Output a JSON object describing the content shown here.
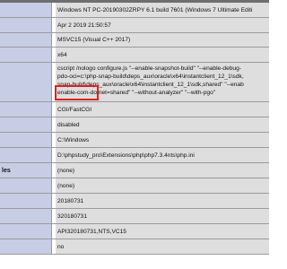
{
  "phpinfo": {
    "rows": [
      {
        "label": "",
        "value": "Windows NT PC-20190302ZRPY 6.1 build 7601 (Windows 7 Ultimate Editi"
      },
      {
        "label": "",
        "value": "Apr 2 2019 21:50:57"
      },
      {
        "label": "",
        "value": "MSVC15 (Visual C++ 2017)"
      },
      {
        "label": "",
        "value": "x64"
      },
      {
        "label": "",
        "lines": [
          "cscript /nologo configure.js \"--enable-snapshot-build\" \"--enable-debug-",
          "pdo-oci=c:\\php-snap-build\\deps_aux\\oracle\\x64\\instantclient_12_1\\sdk,",
          "snap-build\\deps_aux\\oracle\\x64\\instantclient_12_1\\sdk,shared\" \"--enab",
          "enable-com-dotnet=shared\" \"--without-analyzer\" \"--with-pgo\""
        ]
      },
      {
        "label": "",
        "value": "CGI/FastCGI"
      },
      {
        "label": "",
        "value": "disabled"
      },
      {
        "label": "",
        "value": "C:\\Windows"
      },
      {
        "label": "",
        "value": "D:\\phpstudy_pro\\Extensions\\php\\php7.3.4nts\\php.ini"
      },
      {
        "label": "les",
        "value": "(none)"
      },
      {
        "label": "",
        "value": "(none)"
      },
      {
        "label": "",
        "value": "20180731"
      },
      {
        "label": "",
        "value": "320180731"
      },
      {
        "label": "",
        "value": "API320180731,NTS,VC15"
      },
      {
        "label": "",
        "value": "no"
      }
    ]
  }
}
